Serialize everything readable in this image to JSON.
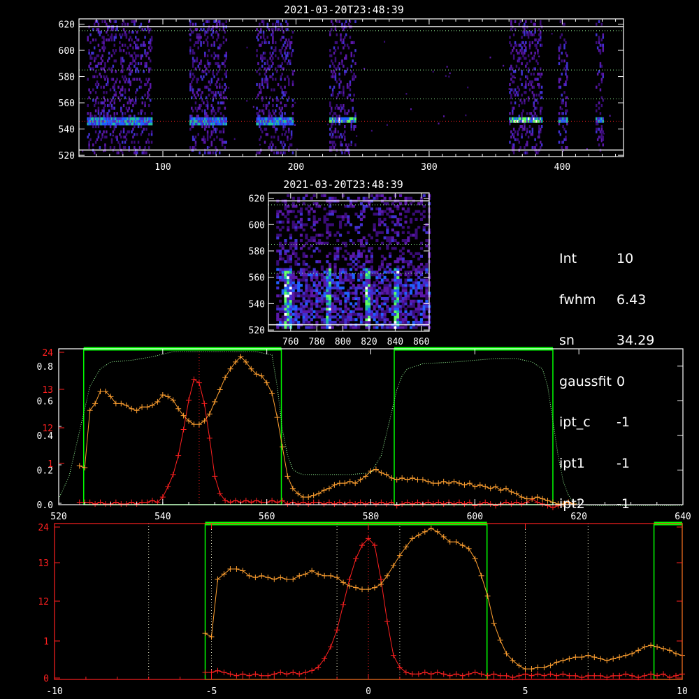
{
  "panels": {
    "top": {
      "title": "2021-03-20T23:48:39",
      "xticks": [
        "100",
        "200",
        "300",
        "400"
      ],
      "yticks": [
        "520",
        "540",
        "560",
        "580",
        "600",
        "620"
      ],
      "xlim": [
        37,
        446
      ],
      "ylim": [
        519,
        624
      ],
      "ref_lines": {
        "white": [
          524,
          618
        ],
        "green_dotted": [
          615,
          585,
          563
        ],
        "red_dotted": [
          546
        ]
      },
      "columns": [
        {
          "x0": 43,
          "x1": 92,
          "mid": 545,
          "peak": "blue"
        },
        {
          "x0": 120,
          "x1": 148,
          "mid": 545,
          "peak": "blue"
        },
        {
          "x0": 170,
          "x1": 198,
          "mid": 545,
          "peak": "blue"
        },
        {
          "x0": 225,
          "x1": 245,
          "mid": 546,
          "peak": "green"
        },
        {
          "x0": 360,
          "x1": 385,
          "mid": 546,
          "peak": "green"
        },
        {
          "x0": 397,
          "x1": 404,
          "mid": 546,
          "peak": "blue"
        },
        {
          "x0": 425,
          "x1": 431,
          "mid": 546,
          "peak": "blue"
        }
      ]
    },
    "mid": {
      "title": "2021-03-20T23:48:39",
      "xticks": [
        "760",
        "780",
        "800",
        "820",
        "840",
        "860"
      ],
      "yticks": [
        "520",
        "540",
        "560",
        "580",
        "600",
        "620"
      ],
      "xlim": [
        743,
        866
      ],
      "ylim": [
        519,
        624
      ],
      "streaks": [
        757,
        788,
        818,
        840
      ]
    },
    "info": [
      {
        "key": "Int",
        "value": "10"
      },
      {
        "key": "fwhm",
        "value": "6.43"
      },
      {
        "key": "sn",
        "value": "34.29"
      },
      {
        "key": "gaussfit",
        "value": "0"
      },
      {
        "key": "ipt_c",
        "value": "-1"
      },
      {
        "key": "ipt1",
        "value": "-1"
      },
      {
        "key": "ipt2",
        "value": "-1"
      }
    ],
    "spectrum": {
      "xticks": [
        "520",
        "540",
        "560",
        "580",
        "600",
        "620",
        "640"
      ],
      "yticks_white": [
        "0.0",
        "0.2",
        "0.4",
        "0.6",
        "0.8"
      ],
      "yticks_red": [
        "0",
        "1",
        "12",
        "13",
        "24"
      ],
      "yticks_red_left": [
        "1",
        "12",
        "13",
        "24"
      ]
    },
    "zoom": {
      "xticks": [
        "-10",
        "-5",
        "0",
        "5",
        "10"
      ],
      "yticks_red": [
        "0",
        "1",
        "12",
        "13",
        "24"
      ]
    }
  },
  "colors": {
    "orange": "#ffa030",
    "red": "#ff2020",
    "green": "#00ff00",
    "greendot": "#9aff9a",
    "purple": "#5a18a8"
  },
  "chart_data": [
    {
      "type": "heatmap",
      "title": "2021-03-20T23:48:39",
      "xlim": [
        37,
        446
      ],
      "ylim": [
        519,
        624
      ],
      "bright_bands": [
        [
          43,
          92
        ],
        [
          120,
          148
        ],
        [
          170,
          198
        ],
        [
          225,
          245
        ],
        [
          360,
          385
        ],
        [
          397,
          404
        ],
        [
          425,
          431
        ]
      ],
      "emission_line_y": 546
    },
    {
      "type": "heatmap",
      "title": "2021-03-20T23:48:39",
      "xlim": [
        743,
        866
      ],
      "ylim": [
        519,
        624
      ],
      "bright_streaks_x": [
        757,
        788,
        818,
        840
      ]
    },
    {
      "type": "line",
      "xlim": [
        520,
        640
      ],
      "ylim": [
        0,
        0.9
      ],
      "series": [
        {
          "color": "#ff2020",
          "x": [
            524,
            525,
            526,
            527,
            528,
            529,
            530,
            531,
            532,
            533,
            534,
            535,
            536,
            537,
            538,
            539,
            540,
            541,
            542,
            543,
            544,
            545,
            546,
            547,
            548,
            549,
            550,
            551,
            552,
            553,
            554,
            555,
            556,
            557,
            558,
            559,
            560,
            561,
            562,
            563,
            564,
            565,
            566,
            567,
            568,
            569,
            570,
            571,
            572,
            573,
            574,
            575,
            576,
            577,
            578,
            579,
            580,
            581,
            582,
            583,
            584,
            585,
            586,
            587,
            588,
            589,
            590,
            591,
            592,
            593,
            594,
            595,
            596,
            597,
            598,
            599,
            600,
            601,
            602,
            603,
            604,
            605,
            606,
            607,
            608,
            609,
            610,
            611,
            612,
            613,
            614,
            615,
            616,
            617,
            618,
            619
          ],
          "y": [
            0.03,
            0.03,
            0.03,
            0.02,
            0.03,
            0.02,
            0.02,
            0.03,
            0.02,
            0.02,
            0.03,
            0.02,
            0.03,
            0.03,
            0.04,
            0.03,
            0.06,
            0.12,
            0.19,
            0.3,
            0.45,
            0.62,
            0.74,
            0.72,
            0.6,
            0.4,
            0.18,
            0.08,
            0.04,
            0.03,
            0.04,
            0.03,
            0.04,
            0.03,
            0.04,
            0.03,
            0.03,
            0.04,
            0.03,
            0.04,
            0.02,
            0.03,
            0.02,
            0.03,
            0.02,
            0.03,
            0.03,
            0.02,
            0.03,
            0.02,
            0.03,
            0.02,
            0.03,
            0.02,
            0.03,
            0.02,
            0.03,
            0.02,
            0.03,
            0.02,
            0.03,
            0.01,
            0.02,
            0.03,
            0.02,
            0.03,
            0.02,
            0.03,
            0.02,
            0.03,
            0.02,
            0.03,
            0.02,
            0.03,
            0.02,
            0.03,
            0.01,
            0.02,
            0.03,
            0.02,
            0.01,
            0.02,
            0.03,
            0.02,
            0.03,
            0.02,
            0.03,
            0.05,
            0.03,
            0.02,
            0.01,
            0.0,
            0.01,
            0.02,
            0.03,
            0.02
          ]
        },
        {
          "color": "#ffa030",
          "x": [
            524,
            525,
            526,
            527,
            528,
            529,
            530,
            531,
            532,
            533,
            534,
            535,
            536,
            537,
            538,
            539,
            540,
            541,
            542,
            543,
            544,
            545,
            546,
            547,
            548,
            549,
            550,
            551,
            552,
            553,
            554,
            555,
            556,
            557,
            558,
            559,
            560,
            561,
            562,
            563,
            564,
            565,
            566,
            567,
            568,
            569,
            570,
            571,
            572,
            573,
            574,
            575,
            576,
            577,
            578,
            579,
            580,
            581,
            582,
            583,
            584,
            585,
            586,
            587,
            588,
            589,
            590,
            591,
            592,
            593,
            594,
            595,
            596,
            597,
            598,
            599,
            600,
            601,
            602,
            603,
            604,
            605,
            606,
            607,
            608,
            609,
            610,
            611,
            612,
            613,
            614,
            615,
            616,
            617,
            618,
            619
          ],
          "y": [
            0.24,
            0.23,
            0.56,
            0.6,
            0.67,
            0.67,
            0.64,
            0.6,
            0.6,
            0.59,
            0.57,
            0.56,
            0.58,
            0.58,
            0.59,
            0.61,
            0.65,
            0.64,
            0.62,
            0.57,
            0.53,
            0.5,
            0.48,
            0.48,
            0.5,
            0.54,
            0.61,
            0.68,
            0.75,
            0.8,
            0.84,
            0.87,
            0.84,
            0.8,
            0.77,
            0.76,
            0.72,
            0.66,
            0.52,
            0.35,
            0.18,
            0.11,
            0.08,
            0.06,
            0.06,
            0.07,
            0.08,
            0.1,
            0.11,
            0.13,
            0.14,
            0.14,
            0.15,
            0.14,
            0.16,
            0.18,
            0.21,
            0.22,
            0.2,
            0.19,
            0.17,
            0.16,
            0.17,
            0.16,
            0.17,
            0.16,
            0.16,
            0.15,
            0.14,
            0.14,
            0.15,
            0.14,
            0.15,
            0.14,
            0.13,
            0.14,
            0.12,
            0.13,
            0.12,
            0.11,
            0.12,
            0.1,
            0.11,
            0.09,
            0.08,
            0.06,
            0.05,
            0.05,
            0.06,
            0.05,
            0.04,
            0.03,
            0.02,
            0.02,
            0.03,
            0.02
          ]
        },
        {
          "color": "#9aff9a",
          "style": "dotted",
          "x": [
            520,
            522,
            524,
            526,
            528,
            530,
            534,
            538,
            542,
            546,
            550,
            554,
            558,
            561,
            562,
            563,
            564,
            565,
            566,
            567,
            569,
            572,
            576,
            580,
            582,
            584,
            585,
            586,
            587,
            590,
            596,
            600,
            604,
            608,
            611,
            613,
            614,
            615,
            616,
            617,
            618,
            619,
            620,
            622,
            626,
            630,
            636,
            640
          ],
          "y": [
            0.05,
            0.18,
            0.44,
            0.7,
            0.8,
            0.84,
            0.85,
            0.87,
            0.9,
            0.9,
            0.9,
            0.9,
            0.9,
            0.88,
            0.7,
            0.45,
            0.3,
            0.22,
            0.2,
            0.19,
            0.19,
            0.19,
            0.19,
            0.2,
            0.3,
            0.55,
            0.68,
            0.76,
            0.8,
            0.83,
            0.84,
            0.85,
            0.86,
            0.86,
            0.84,
            0.8,
            0.7,
            0.5,
            0.3,
            0.15,
            0.07,
            0.03,
            0.02,
            0.01,
            0.01,
            0.01,
            0.01,
            0.01
          ]
        }
      ]
    },
    {
      "type": "line",
      "xlim": [
        -10,
        10
      ],
      "series": [
        {
          "color": "#ff2020",
          "x": [
            -5.2,
            -5.0,
            -4.8,
            -4.6,
            -4.4,
            -4.2,
            -4.0,
            -3.8,
            -3.6,
            -3.4,
            -3.2,
            -3.0,
            -2.8,
            -2.6,
            -2.4,
            -2.2,
            -2.0,
            -1.8,
            -1.6,
            -1.4,
            -1.2,
            -1.0,
            -0.8,
            -0.6,
            -0.4,
            -0.2,
            0.0,
            0.2,
            0.4,
            0.6,
            0.8,
            1.0,
            1.2,
            1.4,
            1.6,
            1.8,
            2.0,
            2.2,
            2.4,
            2.6,
            2.8,
            3.0,
            3.2,
            3.4,
            3.6,
            3.8,
            4.0,
            4.2,
            4.4,
            4.6,
            4.8,
            5.0,
            5.2,
            5.4,
            5.6,
            5.8,
            6.0,
            6.2,
            6.4,
            6.6,
            6.8,
            7.0,
            7.2,
            7.4,
            7.6,
            7.8,
            8.0,
            8.2,
            8.4,
            8.6,
            8.8,
            9.0,
            9.2,
            9.4,
            9.6,
            9.8,
            10.0
          ],
          "y": [
            0.05,
            0.05,
            0.06,
            0.05,
            0.04,
            0.03,
            0.04,
            0.03,
            0.04,
            0.03,
            0.03,
            0.04,
            0.05,
            0.04,
            0.05,
            0.04,
            0.05,
            0.06,
            0.08,
            0.13,
            0.2,
            0.3,
            0.45,
            0.6,
            0.72,
            0.8,
            0.84,
            0.8,
            0.6,
            0.35,
            0.15,
            0.08,
            0.05,
            0.04,
            0.04,
            0.05,
            0.04,
            0.05,
            0.04,
            0.03,
            0.04,
            0.03,
            0.04,
            0.05,
            0.04,
            0.03,
            0.04,
            0.03,
            0.03,
            0.02,
            0.03,
            0.04,
            0.03,
            0.04,
            0.03,
            0.04,
            0.03,
            0.04,
            0.03,
            0.03,
            0.02,
            0.03,
            0.03,
            0.03,
            0.02,
            0.03,
            0.03,
            0.04,
            0.03,
            0.02,
            0.03,
            0.04,
            0.03,
            0.04,
            0.02,
            0.03,
            0.04
          ]
        },
        {
          "color": "#ffa030",
          "x": [
            -5.2,
            -5.0,
            -4.8,
            -4.6,
            -4.4,
            -4.2,
            -4.0,
            -3.8,
            -3.6,
            -3.4,
            -3.2,
            -3.0,
            -2.8,
            -2.6,
            -2.4,
            -2.2,
            -2.0,
            -1.8,
            -1.6,
            -1.4,
            -1.2,
            -1.0,
            -0.8,
            -0.6,
            -0.4,
            -0.2,
            0.0,
            0.2,
            0.4,
            0.6,
            0.8,
            1.0,
            1.2,
            1.4,
            1.6,
            1.8,
            2.0,
            2.2,
            2.4,
            2.6,
            2.8,
            3.0,
            3.2,
            3.4,
            3.6,
            3.8,
            4.0,
            4.2,
            4.4,
            4.6,
            4.8,
            5.0,
            5.2,
            5.4,
            5.6,
            5.8,
            6.0,
            6.2,
            6.4,
            6.6,
            6.8,
            7.0,
            7.2,
            7.4,
            7.6,
            7.8,
            8.0,
            8.2,
            8.4,
            8.6,
            8.8,
            9.0,
            9.2,
            9.4,
            9.6,
            9.8,
            10.0
          ],
          "y": [
            0.28,
            0.26,
            0.6,
            0.63,
            0.66,
            0.66,
            0.65,
            0.62,
            0.61,
            0.62,
            0.61,
            0.6,
            0.61,
            0.6,
            0.6,
            0.62,
            0.63,
            0.65,
            0.63,
            0.62,
            0.62,
            0.61,
            0.58,
            0.56,
            0.55,
            0.54,
            0.54,
            0.55,
            0.57,
            0.62,
            0.68,
            0.74,
            0.79,
            0.84,
            0.86,
            0.88,
            0.9,
            0.88,
            0.85,
            0.82,
            0.82,
            0.8,
            0.78,
            0.72,
            0.62,
            0.5,
            0.34,
            0.24,
            0.16,
            0.12,
            0.09,
            0.07,
            0.07,
            0.08,
            0.08,
            0.09,
            0.11,
            0.12,
            0.13,
            0.14,
            0.14,
            0.15,
            0.14,
            0.13,
            0.12,
            0.13,
            0.14,
            0.15,
            0.16,
            0.18,
            0.2,
            0.21,
            0.2,
            0.19,
            0.18,
            0.16,
            0.15
          ]
        }
      ]
    }
  ]
}
